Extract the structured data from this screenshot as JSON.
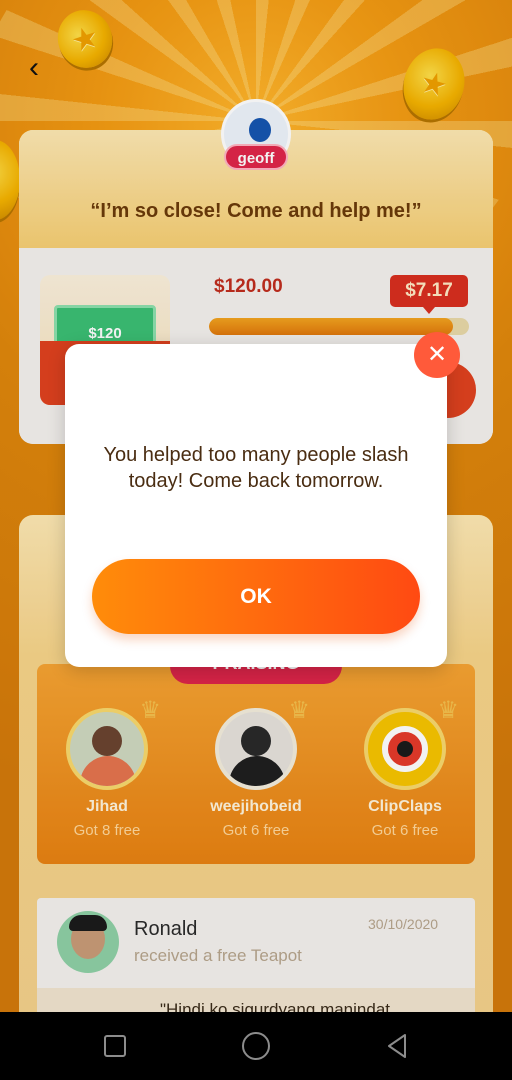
{
  "header": {
    "back_icon": "chevron-left-icon"
  },
  "request": {
    "user_name": "geoff",
    "quote": "“I’m so close! Come and help me!”",
    "prize_image_label": "$120",
    "prize_amount": "$120.00",
    "remaining_amount": "$7.17",
    "progress_fraction": 0.94
  },
  "winners": {
    "tab_label": "PRAISING",
    "items": [
      {
        "name": "Jihad",
        "subtitle": "Got 8 free"
      },
      {
        "name": "weejihobeid",
        "subtitle": "Got 6 free"
      },
      {
        "name": "ClipClaps",
        "subtitle": "Got 6 free"
      }
    ]
  },
  "activity": {
    "items": [
      {
        "name": "Ronald",
        "action": "received a free Teapot",
        "date": "30/10/2020"
      },
      {
        "partial_text": "\"Hindi ko sigurdyang manindat"
      }
    ]
  },
  "dialog": {
    "message": "You helped too many people slash today! Come back tomorrow.",
    "ok_label": "OK",
    "close_icon": "close-icon"
  },
  "colors": {
    "accent_orange": "#ff6a10",
    "close_red": "#ff5a3a",
    "price_red": "#c02d1d",
    "pill_pink": "#e0254a"
  }
}
